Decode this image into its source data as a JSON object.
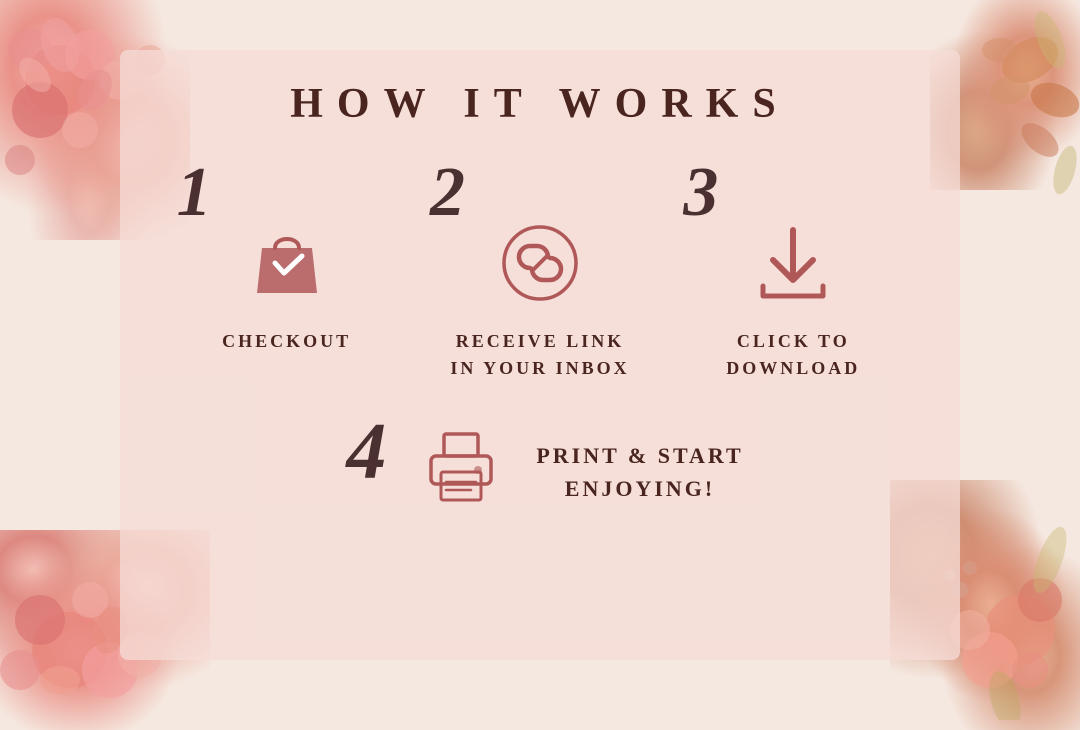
{
  "page": {
    "title": "HOW IT WORKS",
    "background_color": "#f5e8e0",
    "card_color": "rgba(245, 220, 215, 0.75)"
  },
  "steps": [
    {
      "number": "1",
      "icon": "shopping-bag",
      "label": "CHECKOUT"
    },
    {
      "number": "2",
      "icon": "link-circle",
      "label": "RECEIVE LINK\nIN YOUR INBOX"
    },
    {
      "number": "3",
      "icon": "download",
      "label": "CLICK TO\nDOWNLOAD"
    },
    {
      "number": "4",
      "icon": "printer",
      "label": "PRINT & START\nENJOYING!"
    }
  ],
  "accent_color": "#b05858",
  "text_color": "#4a2520"
}
